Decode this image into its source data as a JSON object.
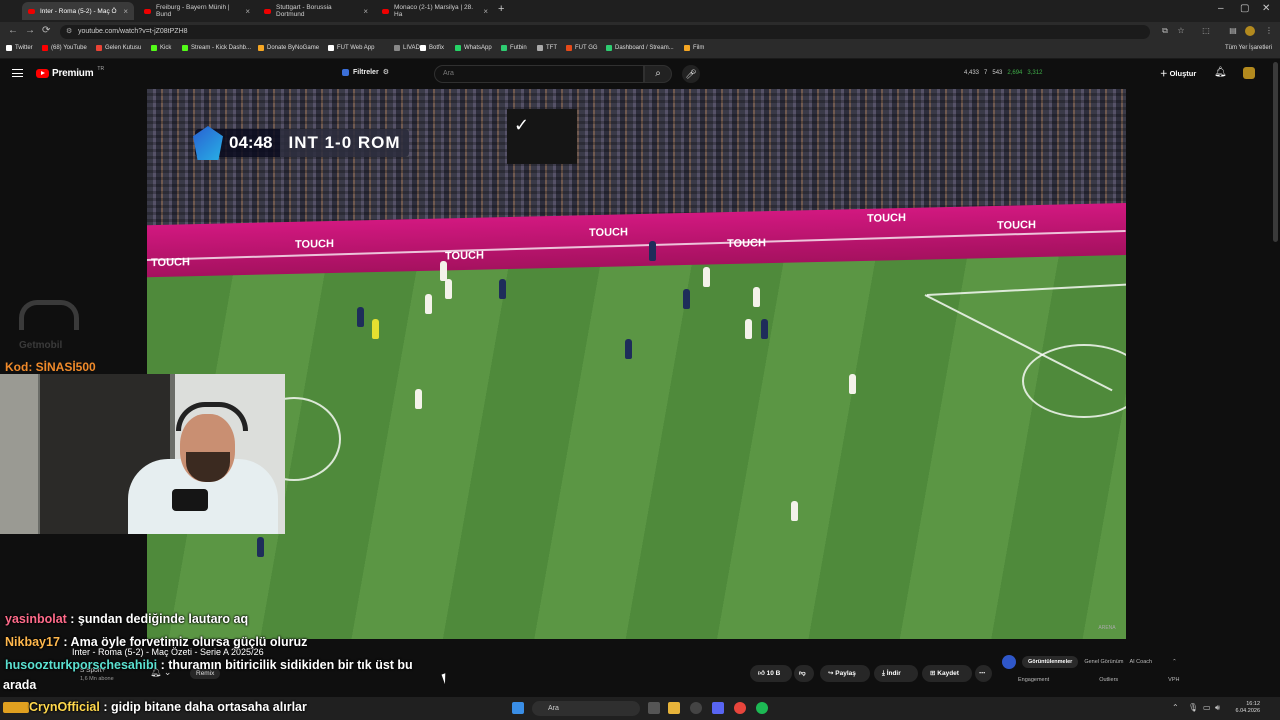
{
  "tabs": [
    {
      "label": "Inter - Roma (5-2) - Maç Ö",
      "active": true
    },
    {
      "label": "Freiburg - Bayern Münih | Bund",
      "active": false
    },
    {
      "label": "Stuttgart - Borussia Dortmund",
      "active": false
    },
    {
      "label": "Monaco (2-1) Marsilya | 28. Ha",
      "active": false
    }
  ],
  "address": {
    "url": "youtube.com/watch?v=t-jZ08tPZH8"
  },
  "bookmarks": [
    {
      "label": "Twitter",
      "color": "#ffffff"
    },
    {
      "label": "(68) YouTube",
      "color": "#ff0000"
    },
    {
      "label": "Gelen Kutusu",
      "color": "#ea4335"
    },
    {
      "label": "Kick",
      "color": "#53fc18"
    },
    {
      "label": "Stream - Kick Dashb...",
      "color": "#53fc18"
    },
    {
      "label": "Donate ByNoGame",
      "color": "#f5a623"
    },
    {
      "label": "FUT Web App",
      "color": "#ffffff"
    },
    {
      "label": "LIVAD",
      "color": "#888888"
    },
    {
      "label": "Botfix",
      "color": "#ffffff"
    },
    {
      "label": "WhatsApp",
      "color": "#25d366"
    },
    {
      "label": "Futbin",
      "color": "#2ecc71"
    },
    {
      "label": "TFT",
      "color": "#aaaaaa"
    },
    {
      "label": "FUT GG",
      "color": "#e64a19"
    },
    {
      "label": "Dashboard / Stream...",
      "color": "#2ecc71"
    },
    {
      "label": "Film",
      "color": "#f5a623"
    }
  ],
  "bookmarks_all": "Tüm Yer İşaretleri",
  "youtube": {
    "logo": "Premium",
    "logo_sup": "TR",
    "filters": "Filtreler",
    "search_placeholder": "Ara",
    "stats": [
      "4,433",
      "7",
      "543",
      "2,694",
      "3,312"
    ],
    "create": "Oluştur"
  },
  "video": {
    "clock": "04:48",
    "score": "INT  1-0  ROM",
    "board_text": "TOUCH",
    "watermark": "ARENA"
  },
  "overlay": {
    "sponsor": "Getmobil",
    "code": "Kod: SİNASİ500"
  },
  "chat": [
    {
      "user": "yasinbolat",
      "msg": " : şundan dediğinde lautaro aq"
    },
    {
      "user": "Nikbay17",
      "msg": " : Ama öyle forvetimiz olursa güçlü oluruz"
    },
    {
      "user": "husoozturkporschesahibi",
      "msg": " : thuramın bitiricilik sidikiden bir tık üst bu"
    },
    {
      "user": "",
      "msg": "arada"
    },
    {
      "user": "CrynOfficial",
      "msg": " : gidip bitane daha ortasaha alırlar"
    }
  ],
  "below": {
    "title": "Inter - Roma (5-2) - Maç Özeti - Serie A 2025/26",
    "channel": "S Sport+",
    "subs": "1,6 Mn abone",
    "remix": "Remix",
    "likes": "10 B",
    "share": "Paylaş",
    "download": "İndir",
    "save": "Kaydet",
    "panel_tabs": [
      "Görüntülenmeler",
      "Genel Görünüm",
      "AI Coach"
    ],
    "panel_cols": [
      "Engagement",
      "Outliers",
      "VPH"
    ]
  },
  "taskbar": {
    "search": "Ara",
    "time": "16:12",
    "date": "6.04.2026"
  }
}
